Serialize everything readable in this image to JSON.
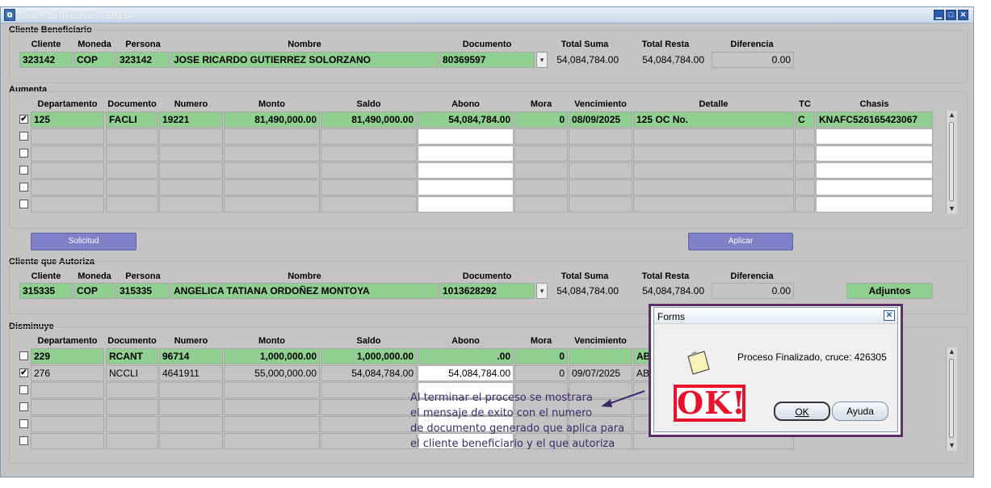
{
  "window": {
    "title": "Cruce de Terceros - 59154",
    "icon_name": "app-icon"
  },
  "sections": {
    "beneficiario": "Cliente Beneficiario",
    "aumenta": "Aumenta",
    "autoriza": "Cliente que Autoriza",
    "disminuye": "Disminuye"
  },
  "client_headers": {
    "cliente": "Cliente",
    "moneda": "Moneda",
    "persona": "Persona",
    "nombre": "Nombre",
    "documento": "Documento",
    "total_suma": "Total Suma",
    "total_resta": "Total Resta",
    "diferencia": "Diferencia"
  },
  "beneficiario": {
    "cliente": "323142",
    "moneda": "COP",
    "persona": "323142",
    "nombre": "JOSE RICARDO GUTIERREZ SOLORZANO",
    "documento": "80369597",
    "total_suma": "54,084,784.00",
    "total_resta": "54,084,784.00",
    "diferencia": "0.00"
  },
  "autoriza": {
    "cliente": "315335",
    "moneda": "COP",
    "persona": "315335",
    "nombre": "ANGELICA TATIANA ORDOÑEZ MONTOYA",
    "documento": "1013628292",
    "total_suma": "54,084,784.00",
    "total_resta": "54,084,784.00",
    "diferencia": "0.00",
    "adjuntos_label": "Adjuntos"
  },
  "grid_headers": {
    "departamento": "Departamento",
    "documento": "Documento",
    "numero": "Numero",
    "monto": "Monto",
    "saldo": "Saldo",
    "abono": "Abono",
    "mora": "Mora",
    "vencimiento": "Vencimiento",
    "detalle": "Detalle",
    "tc": "TC",
    "chasis": "Chasis"
  },
  "aumenta_rows": [
    {
      "checked": "✔",
      "departamento": "125",
      "documento": "FACLI",
      "numero": "19221",
      "monto": "81,490,000.00",
      "saldo": "81,490,000.00",
      "abono": "54,084,784.00",
      "mora": "0",
      "vencimiento": "08/09/2025",
      "detalle": "125 OC No.",
      "tc": "C",
      "chasis": "KNAFC526165423067"
    }
  ],
  "disminuye_rows": [
    {
      "checked": "",
      "departamento": "229",
      "documento": "RCANT",
      "numero": "96714",
      "monto": "1,000,000.00",
      "saldo": "1,000,000.00",
      "abono": ".00",
      "mora": "0",
      "vencimiento": "",
      "detalle": "ABC"
    },
    {
      "checked": "✔",
      "departamento": "276",
      "documento": "NCCLI",
      "numero": "4641911",
      "monto": "55,000,000.00",
      "saldo": "54,084,784.00",
      "abono": "54,084,784.00",
      "mora": "0",
      "vencimiento": "09/07/2025",
      "detalle": "ABC"
    }
  ],
  "buttons": {
    "solicitud": "Solicitud",
    "aplicar": "Aplicar"
  },
  "dialog": {
    "title": "Forms",
    "message": "Proceso Finalizado, cruce: 426305",
    "ok_label": "OK",
    "ayuda_label": "Ayuda"
  },
  "stamp_text": "OK!",
  "annotation": {
    "line1": "Al terminar el proceso se mostrara",
    "line2": "el mensaje de exito con el numero",
    "line3": "de documento generado que aplica para",
    "line4": "el cliente beneficiario y el que autoriza"
  },
  "colors": {
    "highlight_green": "#8fcf8f",
    "button_purple": "#7f80c7",
    "stamp_red": "#e8132a",
    "annotation_purple": "#3c2a6a",
    "dialog_border": "#5b2e6a"
  }
}
